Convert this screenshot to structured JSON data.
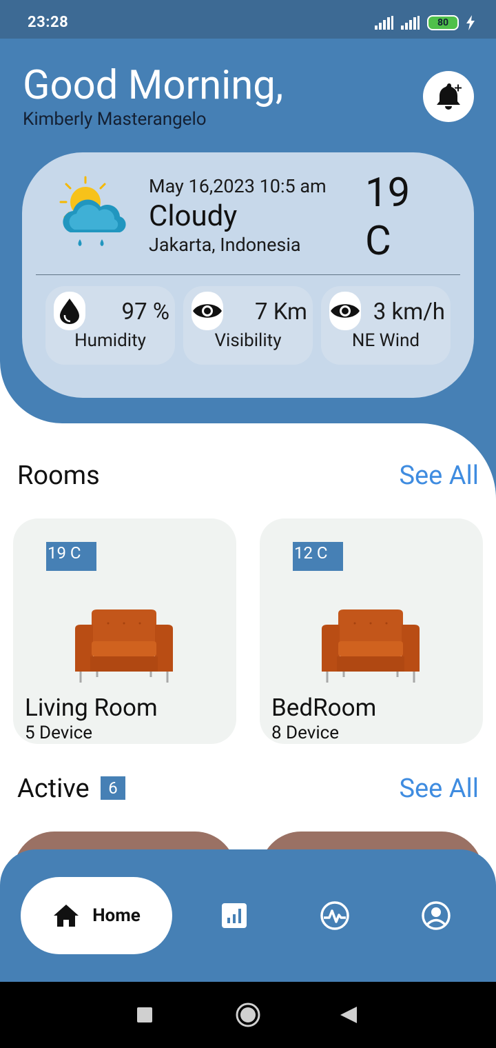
{
  "status_bar": {
    "time": "23:28",
    "battery": "80"
  },
  "header": {
    "greeting": "Good Morning,",
    "user_name": "Kimberly Masterangelo"
  },
  "weather": {
    "date": "May 16,2023 10:5 am",
    "condition": "Cloudy",
    "location": "Jakarta, Indonesia",
    "temperature": "19 C",
    "stats": [
      {
        "icon": "water-drop-icon",
        "value": "97 %",
        "label": "Humidity"
      },
      {
        "icon": "eye-icon",
        "value": "7 Km",
        "label": "Visibility"
      },
      {
        "icon": "eye-icon",
        "value": "3 km/h",
        "label": "NE Wind"
      }
    ]
  },
  "rooms": {
    "title": "Rooms",
    "see_all": "See All",
    "items": [
      {
        "temp": "19 C",
        "name": "Living Room",
        "devices": "5 Device"
      },
      {
        "temp": "12 C",
        "name": "BedRoom",
        "devices": "8 Device"
      }
    ]
  },
  "active": {
    "title": "Active",
    "count": "6",
    "see_all": "See All"
  },
  "nav": {
    "home_label": "Home"
  },
  "colors": {
    "primary": "#4680b5",
    "card": "#c7d8ea",
    "link": "#3f8ce0",
    "room_bg": "#f0f3f1"
  }
}
